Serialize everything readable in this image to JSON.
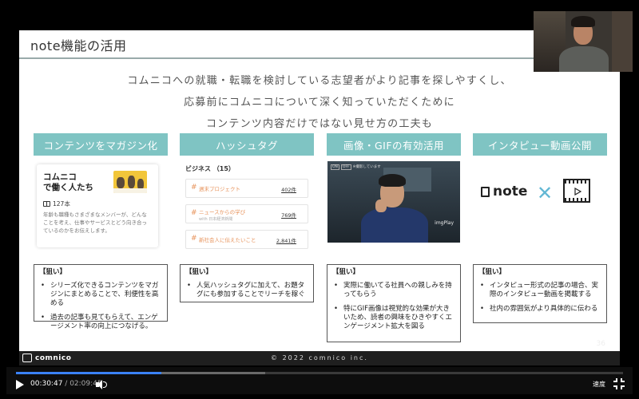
{
  "slide": {
    "title": "note機能の活用",
    "intro": [
      "コムニコへの就職・転職を検討している志望者がより記事を探しやすくし、",
      "応募前にコムニコについて深く知っていただくために",
      "コンテンツ内容だけではない見せ方の工夫も"
    ],
    "columns": [
      {
        "heading": "コンテンツをマガジン化"
      },
      {
        "heading": "ハッシュタグ"
      },
      {
        "heading": "画像・GIFの有効活用"
      },
      {
        "heading": "インタピュー動画公開"
      }
    ],
    "magazine_card": {
      "title_line1": "コムニコ",
      "title_line2": "で働く人たち",
      "count": "127本",
      "description": "年齢も職種もさまざまなメンバーが、どんなことを考え、仕事やサービスとどう向き合っているのかをお伝えします。"
    },
    "hashtag_card": {
      "heading": "ビジネス （15）",
      "tags": [
        {
          "name": "週末プロジェクト",
          "sub": "",
          "count": "402件"
        },
        {
          "name": "ニュースからの学び",
          "sub": "with 日本経済新聞",
          "count": "769件"
        },
        {
          "name": "新社会人に伝えたいこと",
          "sub": "",
          "count": "2,841件"
        }
      ]
    },
    "gif": {
      "ui_labels": [
        "ON",
        "OFF"
      ],
      "ui_text": "※撮影しています",
      "watermark": "imgPlay"
    },
    "note_video": {
      "note_text": "note",
      "x_text": "✕"
    },
    "aims": [
      {
        "label": "【狙い】",
        "items": [
          "シリーズ化できるコンテンツをマガジンにまとめることで、利便性を高める",
          "過去の記事も見てもらえて、エンゲージメント率の向上につなげる。"
        ]
      },
      {
        "label": "【狙い】",
        "items": [
          "人気ハッシュタグに加えて、お題タグにも参加することでリーチを稼ぐ"
        ]
      },
      {
        "label": "【狙い】",
        "items": [
          "実際に働いてる社員への親しみを持ってもらう",
          "特にGIF画像は視覚的な効果が大きいため、読者の興味をひきやすくエンゲージメント拡大を図る"
        ]
      },
      {
        "label": "【狙い】",
        "items": [
          "インタピュー形式の記事の場合、実際のインタピュー動画を掲載する",
          "社内の雰囲気がより具体的に伝わる"
        ]
      }
    ],
    "footer": {
      "brand": "comnico",
      "copyright": "© 2022 comnico inc.",
      "page_number": "36"
    }
  },
  "player": {
    "current_time": "00:30:47",
    "separator": " / ",
    "total_time": "02:09:45",
    "progress": 0.24,
    "buffered": 0.41,
    "speed_label": "速度",
    "accent_color": "#3b82f6"
  },
  "colors": {
    "header_teal": "#7fc4c3",
    "hashtag_orange": "#e7925a",
    "x_blue": "#62b7d4"
  }
}
